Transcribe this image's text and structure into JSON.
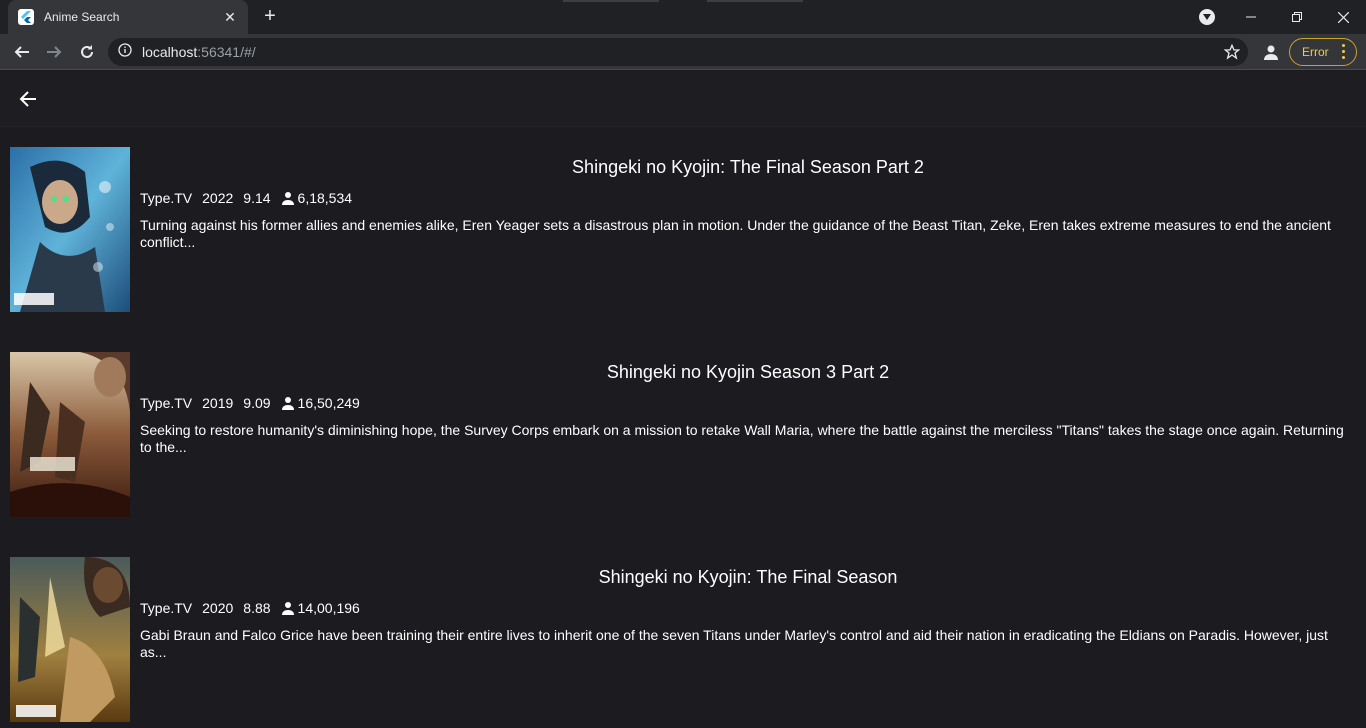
{
  "browser": {
    "tab_title": "Anime Search",
    "url_host": "localhost",
    "url_rest": ":56341/#/",
    "error_label": "Error"
  },
  "results": [
    {
      "title": "Shingeki no Kyojin: The Final Season Part 2",
      "type": "Type.TV",
      "year": "2022",
      "score": "9.14",
      "members": "6,18,534",
      "synopsis": "Turning against his former allies and enemies alike, Eren Yeager sets a disastrous plan in motion. Under the guidance of the Beast Titan, Zeke, Eren takes extreme measures to end the ancient conflict..."
    },
    {
      "title": "Shingeki no Kyojin Season 3 Part 2",
      "type": "Type.TV",
      "year": "2019",
      "score": "9.09",
      "members": "16,50,249",
      "synopsis": "Seeking to restore humanity's diminishing hope, the Survey Corps embark on a mission to retake Wall Maria, where the battle against the merciless \"Titans\" takes the stage once again. Returning to the..."
    },
    {
      "title": "Shingeki no Kyojin: The Final Season",
      "type": "Type.TV",
      "year": "2020",
      "score": "8.88",
      "members": "14,00,196",
      "synopsis": " Gabi Braun and Falco Grice have been training their entire lives to inherit one of the seven Titans under Marley's control and aid their nation in eradicating the Eldians on Paradis. However, just as..."
    }
  ]
}
